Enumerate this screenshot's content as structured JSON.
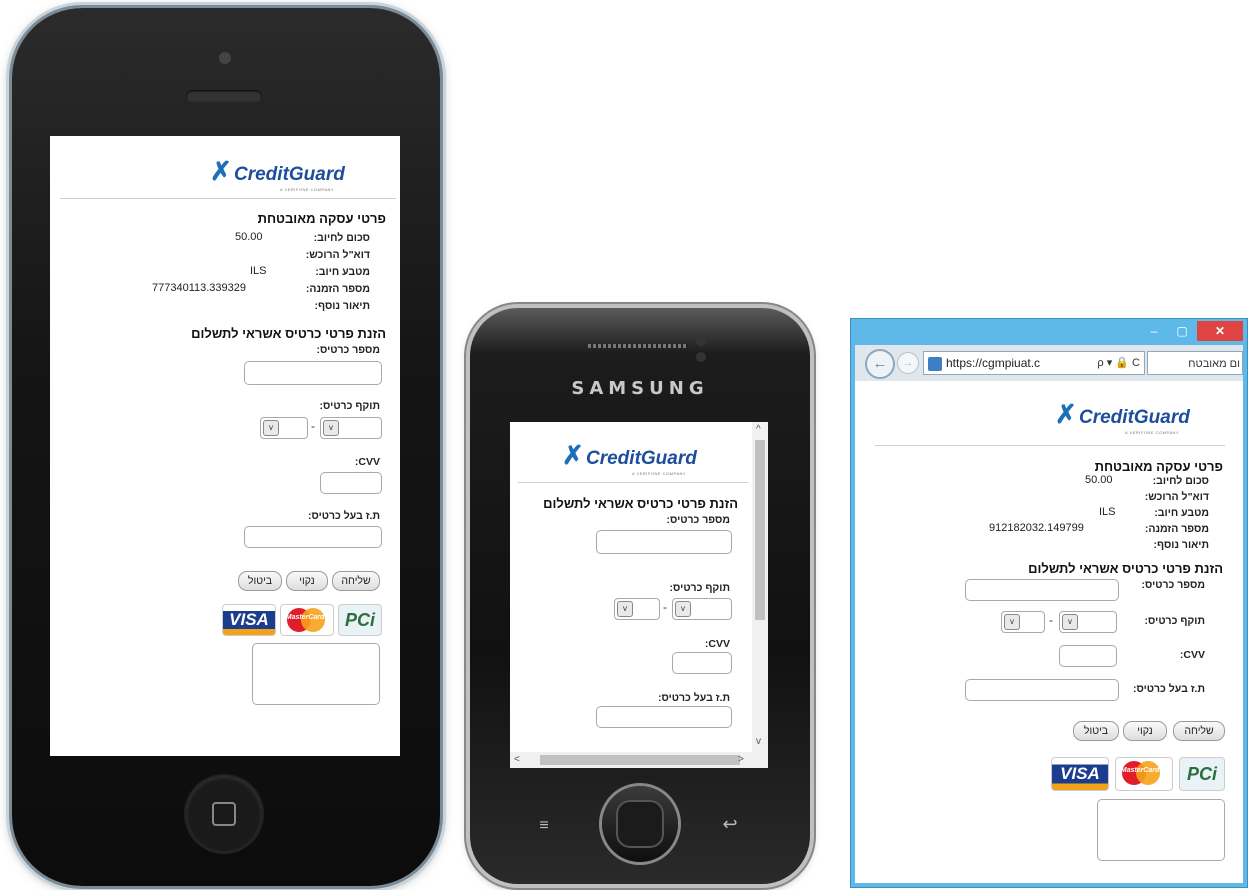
{
  "brand": {
    "logo_text": "CreditGuard",
    "logo_sub": "A VERIFONE COMPANY"
  },
  "samsung": {
    "brand_label": "SAMSUNG"
  },
  "ie": {
    "address_url": "https://cgmpiuat.c",
    "tab_title": "ום מאובטח",
    "back_glyph": "←",
    "forward_glyph": "→",
    "addr_icons": "ρ ▾ 🔒 C",
    "minimize": "–",
    "maximize": "▢",
    "close": "✕"
  },
  "form": {
    "secure_title": "פרטי עסקה מאובטחת",
    "amount_label": "סכום לחיוב:",
    "email_label": "דוא\"ל הרוכש:",
    "currency_label": "מטבע חיוב:",
    "order_label": "מספר הזמנה:",
    "extra_label": "תיאור נוסף:",
    "entry_title": "הזנת פרטי כרטיס אשראי לתשלום",
    "card_number_label": "מספר כרטיס:",
    "expiry_label": "תוקף כרטיס:",
    "cvv_label": "CVV:",
    "id_label": "ת.ז בעל כרטיס:",
    "dash": "-",
    "select_arrow": "v",
    "send_button": "שליחה",
    "clear_button": "נקוי",
    "cancel_button": "ביטול",
    "visa_logo": "VISA",
    "mastercard_logo": "MasterCard",
    "pci_logo": "PCi"
  },
  "iphone_txn": {
    "amount": "50.00",
    "currency": "ILS",
    "order_number": "777340113.339329"
  },
  "ie_txn": {
    "amount": "50.00",
    "currency": "ILS",
    "order_number": "912182032.149799"
  },
  "colors": {
    "brand_blue": "#1d4e9c",
    "ie_frame": "#5fb9e8",
    "close_red": "#e04343"
  }
}
